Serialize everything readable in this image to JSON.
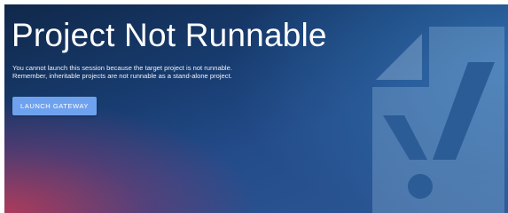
{
  "error_page": {
    "title": "Project Not Runnable",
    "message_lines": [
      "You cannot launch this session because the target project is not runnable.",
      "Remember, inheritable projects are not runnable as a stand-alone project."
    ],
    "launch_button_label": "LAUNCH GATEWAY",
    "illustration_icon": "document-exclamation-icon"
  },
  "colors": {
    "background_top": "#10284a",
    "background_bottom_left": "#b43a58",
    "button_background": "#6fa2ee",
    "text": "#ffffff"
  }
}
